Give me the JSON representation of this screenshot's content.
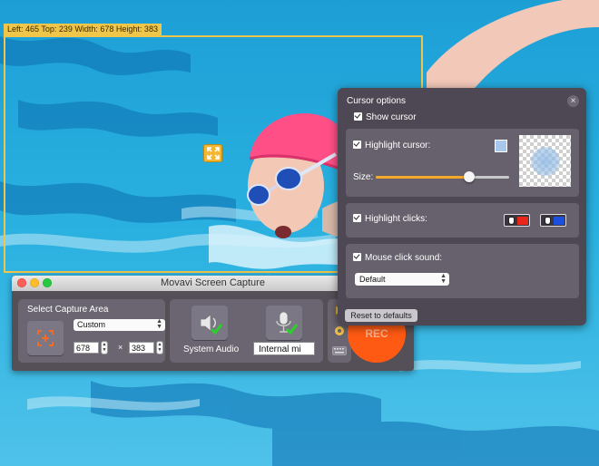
{
  "capture_overlay": {
    "dimensions_label": "Left: 465  Top: 239  Width: 678  Height: 383",
    "move_handle_icon": "move-arrows-icon"
  },
  "movavi_window": {
    "title": "Movavi Screen Capture",
    "capture_area": {
      "heading": "Select Capture Area",
      "preset": "Custom",
      "width": "678",
      "height": "383",
      "separator": "×"
    },
    "audio": {
      "system_audio_label": "System Audio",
      "microphone_value": "Internal mi"
    },
    "rec_label": "REC"
  },
  "cursor_options": {
    "title": "Cursor options",
    "show_cursor": "Show cursor",
    "highlight_cursor": "Highlight cursor:",
    "size_label": "Size:",
    "size_value": 0.7,
    "highlight_color": "#a9c7ea",
    "highlight_clicks": "Highlight clicks:",
    "left_click_color": "#e8261a",
    "right_click_color": "#1b4fe0",
    "mouse_click_sound": "Mouse click sound:",
    "sound_value": "Default",
    "reset_label": "Reset to defaults"
  },
  "colors": {
    "accent": "#f0c64a",
    "rec": "#ff5a13"
  }
}
